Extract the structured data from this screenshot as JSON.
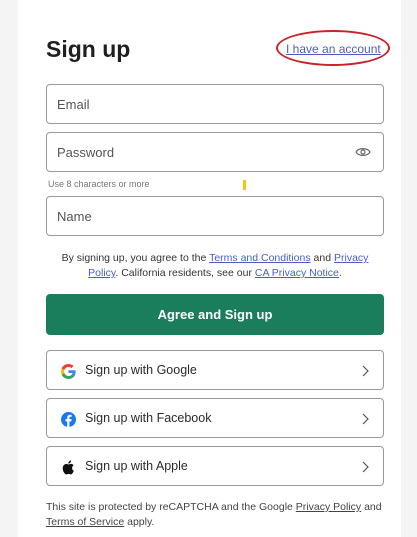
{
  "header": {
    "title": "Sign up",
    "have_account_link": "I have an account"
  },
  "form": {
    "email_placeholder": "Email",
    "password_placeholder": "Password",
    "password_hint": "Use 8 characters or more",
    "name_placeholder": "Name"
  },
  "terms": {
    "prefix": "By signing up, you agree to the ",
    "terms_link": "Terms and Conditions",
    "and": " and ",
    "privacy_link": "Privacy Policy",
    "middle": ". California residents, see our ",
    "ca_link": "CA Privacy Notice",
    "suffix": "."
  },
  "primary_button": {
    "label": "Agree and Sign up"
  },
  "social_buttons": [
    {
      "label": "Sign up with Google",
      "icon": "google-icon"
    },
    {
      "label": "Sign up with Facebook",
      "icon": "facebook-icon"
    },
    {
      "label": "Sign up with Apple",
      "icon": "apple-icon"
    }
  ],
  "recaptcha": {
    "prefix": "This site is protected by reCAPTCHA and the Google ",
    "privacy_link": "Privacy Policy",
    "and": " and ",
    "tos_link": "Terms of Service",
    "suffix": " apply."
  },
  "colors": {
    "primary": "#1a7d5c",
    "link": "#4a5ec2",
    "annotation": "#c8242a",
    "facebook": "#1877f2"
  }
}
